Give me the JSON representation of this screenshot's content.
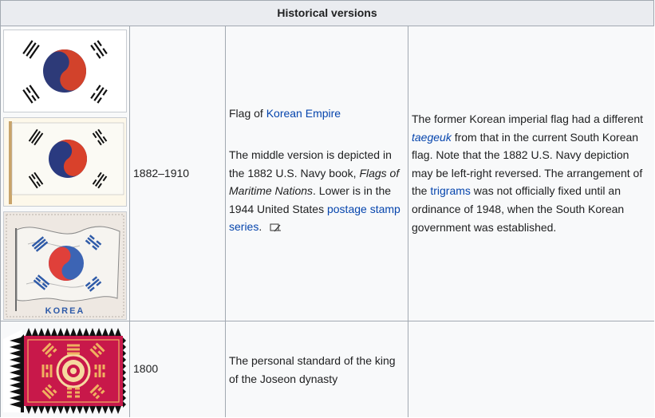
{
  "table": {
    "caption": "Historical versions",
    "rows": [
      {
        "years": "1882–1910",
        "description": {
          "prefix": "Flag of ",
          "link": "Korean Empire",
          "p2_a": "The middle version is depicted in the 1882 U.S. Navy book, ",
          "p2_em": "Flags of Maritime Nations",
          "p2_b": ". Lower is in the 1944 United States ",
          "p2_link": "postage stamp series",
          "p2_c": "."
        },
        "notes": {
          "a": "The former Korean imperial flag had a different ",
          "link1": "taegeuk",
          "b": " from that in the current South Korean flag. Note that the 1882 U.S. Navy depiction may be left-right reversed. The arrangement of the ",
          "link2": "trigrams",
          "c": " was not officially fixed until an ordinance of 1948, when the South Korean government was established."
        },
        "stamp_text": "KOREA"
      },
      {
        "years": "1800",
        "description": {
          "text": "The personal standard of the king of the Joseon dynasty"
        },
        "notes": ""
      }
    ]
  },
  "colors": {
    "header_bg": "#eaecf0",
    "cell_bg": "#f8f9fa",
    "border": "#a2a9b1",
    "link": "#0645ad",
    "taegeuk_red": "#d2422b",
    "taegeuk_blue": "#2d3a78",
    "royal_crimson": "#c8184a",
    "royal_gold": "#f0b060"
  },
  "icons": {
    "external_link": "edit-external-icon"
  }
}
